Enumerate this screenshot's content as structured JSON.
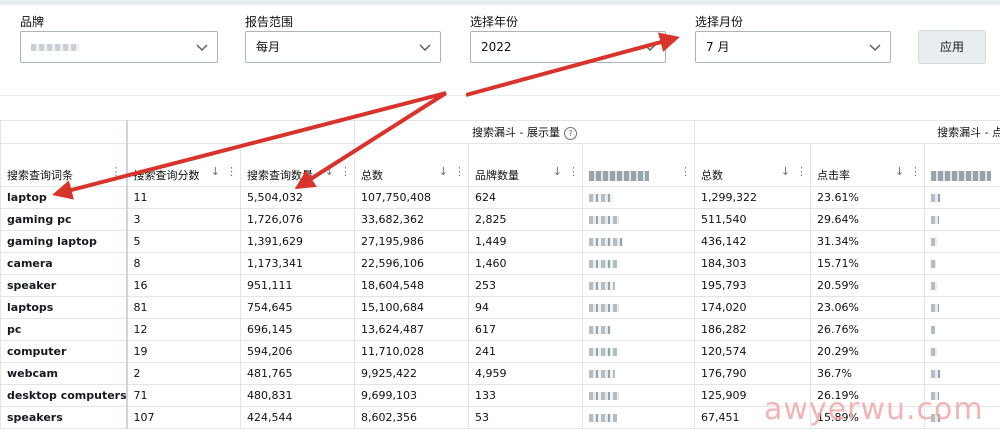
{
  "filters": {
    "brand": {
      "label": "品牌",
      "value": ""
    },
    "range": {
      "label": "报告范围",
      "value": "每月"
    },
    "year": {
      "label": "选择年份",
      "value": "2022"
    },
    "month": {
      "label": "选择月份",
      "value": "7 月"
    },
    "apply_label": "应用"
  },
  "table": {
    "group_impressions": "搜索漏斗 - 展示量",
    "group_clicks": "搜索漏斗 - 点击",
    "columns": [
      "搜索查询词条",
      "搜索查询分数",
      "搜索查询数量",
      "总数",
      "品牌数量",
      "",
      "总数",
      "点击率",
      ""
    ],
    "rows": [
      {
        "term": "laptop",
        "score": "11",
        "volume": "5,504,032",
        "imp_total": "107,750,408",
        "imp_brand": "624",
        "clk_total": "1,299,322",
        "ctr": "23.61%"
      },
      {
        "term": "gaming pc",
        "score": "3",
        "volume": "1,726,076",
        "imp_total": "33,682,362",
        "imp_brand": "2,825",
        "clk_total": "511,540",
        "ctr": "29.64%"
      },
      {
        "term": "gaming laptop",
        "score": "5",
        "volume": "1,391,629",
        "imp_total": "27,195,986",
        "imp_brand": "1,449",
        "clk_total": "436,142",
        "ctr": "31.34%"
      },
      {
        "term": "camera",
        "score": "8",
        "volume": "1,173,341",
        "imp_total": "22,596,106",
        "imp_brand": "1,460",
        "clk_total": "184,303",
        "ctr": "15.71%"
      },
      {
        "term": "speaker",
        "score": "16",
        "volume": "951,111",
        "imp_total": "18,604,548",
        "imp_brand": "253",
        "clk_total": "195,793",
        "ctr": "20.59%"
      },
      {
        "term": "laptops",
        "score": "81",
        "volume": "754,645",
        "imp_total": "15,100,684",
        "imp_brand": "94",
        "clk_total": "174,020",
        "ctr": "23.06%"
      },
      {
        "term": "pc",
        "score": "12",
        "volume": "696,145",
        "imp_total": "13,624,487",
        "imp_brand": "617",
        "clk_total": "186,282",
        "ctr": "26.76%"
      },
      {
        "term": "computer",
        "score": "19",
        "volume": "594,206",
        "imp_total": "11,710,028",
        "imp_brand": "241",
        "clk_total": "120,574",
        "ctr": "20.29%"
      },
      {
        "term": "webcam",
        "score": "2",
        "volume": "481,765",
        "imp_total": "9,925,422",
        "imp_brand": "4,959",
        "clk_total": "176,790",
        "ctr": "36.7%"
      },
      {
        "term": "desktop computers",
        "score": "71",
        "volume": "480,831",
        "imp_total": "9,699,103",
        "imp_brand": "133",
        "clk_total": "125,909",
        "ctr": "26.19%"
      },
      {
        "term": "speakers",
        "score": "107",
        "volume": "424,544",
        "imp_total": "8,602,356",
        "imp_brand": "53",
        "clk_total": "67,451",
        "ctr": "15.89%"
      }
    ]
  },
  "watermark": "awyerwu.com",
  "colors": {
    "arrow": "#d9342b",
    "border": "#aab7b8",
    "watermark": "#f0a8a8"
  },
  "icons": {
    "sort": "sort-down-icon",
    "menu": "kebab-menu-icon",
    "dropdown": "chevron-down-icon",
    "info": "info-icon"
  }
}
